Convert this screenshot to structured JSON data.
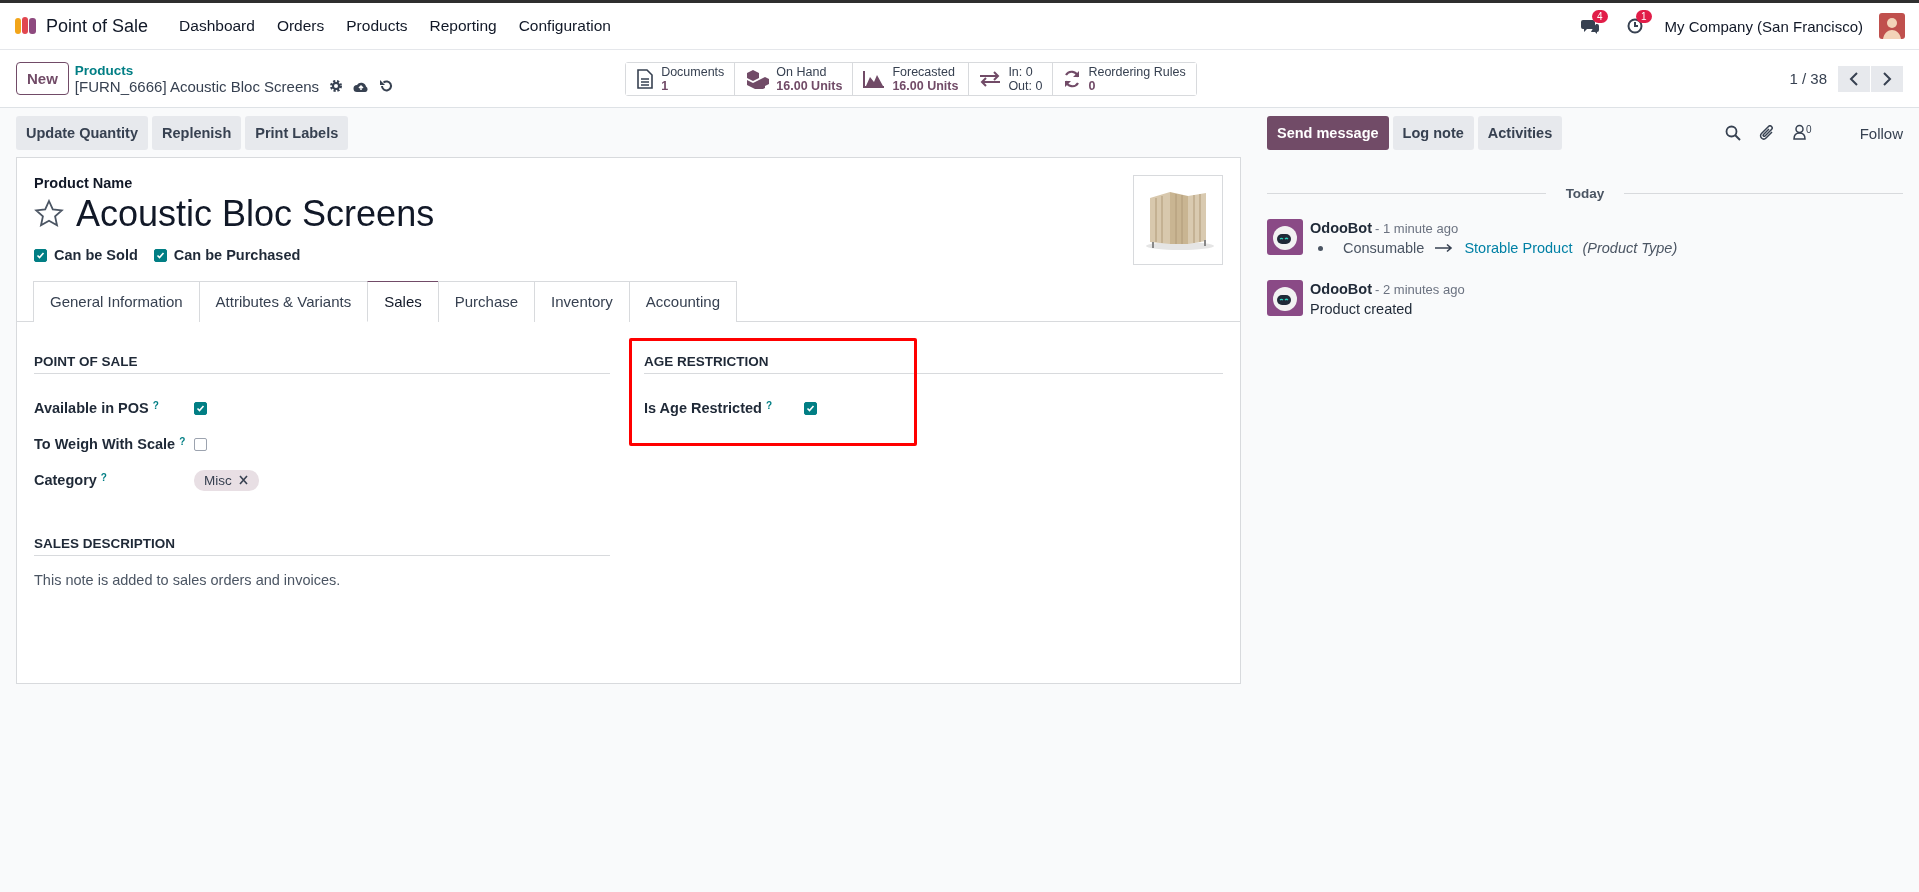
{
  "navbar": {
    "app": "Point of Sale",
    "menu": [
      "Dashboard",
      "Orders",
      "Products",
      "Reporting",
      "Configuration"
    ],
    "messages_count": "4",
    "activities_count": "1",
    "company": "My Company (San Francisco)"
  },
  "control_panel": {
    "new_button": "New",
    "breadcrumb": "Products",
    "record": "[FURN_6666] Acoustic Bloc Screens",
    "smart_buttons": [
      {
        "kind": "documents",
        "label": "Documents",
        "value": "1"
      },
      {
        "kind": "on_hand",
        "label": "On Hand",
        "value": "16.00 Units"
      },
      {
        "kind": "forecasted",
        "label": "Forecasted",
        "value": "16.00 Units"
      },
      {
        "kind": "in_out",
        "label": "In: 0",
        "value": "Out: 0"
      },
      {
        "kind": "reordering",
        "label": "Reordering Rules",
        "value": "0"
      }
    ],
    "pager": "1 / 38"
  },
  "action_buttons": [
    "Update Quantity",
    "Replenish",
    "Print Labels"
  ],
  "form": {
    "name_label": "Product Name",
    "name": "Acoustic Bloc Screens",
    "favorite": false,
    "flags": [
      {
        "label": "Can be Sold",
        "checked": true
      },
      {
        "label": "Can be Purchased",
        "checked": true
      }
    ],
    "tabs": [
      {
        "label": "General Information",
        "selected": false
      },
      {
        "label": "Attributes & Variants",
        "selected": false
      },
      {
        "label": "Sales",
        "selected": true
      },
      {
        "label": "Purchase",
        "selected": false
      },
      {
        "label": "Inventory",
        "selected": false
      },
      {
        "label": "Accounting",
        "selected": false
      }
    ],
    "sections": [
      {
        "title": "POINT OF SALE",
        "highlighted": false,
        "fields": [
          {
            "kind": "checkbox",
            "label": "Available in POS",
            "help": "?",
            "checked": true
          },
          {
            "kind": "checkbox",
            "label": "To Weigh With Scale",
            "help": "?",
            "checked": false
          },
          {
            "kind": "tags",
            "label": "Category",
            "help": "?",
            "tags": [
              "Misc"
            ]
          }
        ]
      },
      {
        "title": "AGE RESTRICTION",
        "highlighted": true,
        "fields": [
          {
            "kind": "checkbox",
            "label": "Is Age Restricted",
            "help": "?",
            "checked": true
          }
        ]
      }
    ],
    "sales_description": {
      "title": "SALES DESCRIPTION",
      "text": "This note is added to sales orders and invoices."
    }
  },
  "chatter": {
    "buttons": [
      {
        "label": "Send message",
        "primary": true
      },
      {
        "label": "Log note",
        "primary": false
      },
      {
        "label": "Activities",
        "primary": false
      }
    ],
    "followers_count": "0",
    "follow": "Follow",
    "date_separator": "Today",
    "messages": [
      {
        "kind": "tracking",
        "author": "OdooBot",
        "time": "- 1 minute ago",
        "old_value": "Consumable",
        "new_value": "Storable Product",
        "field": "(Product Type)"
      },
      {
        "kind": "note",
        "author": "OdooBot",
        "time": "- 2 minutes ago",
        "body": "Product created"
      }
    ]
  }
}
